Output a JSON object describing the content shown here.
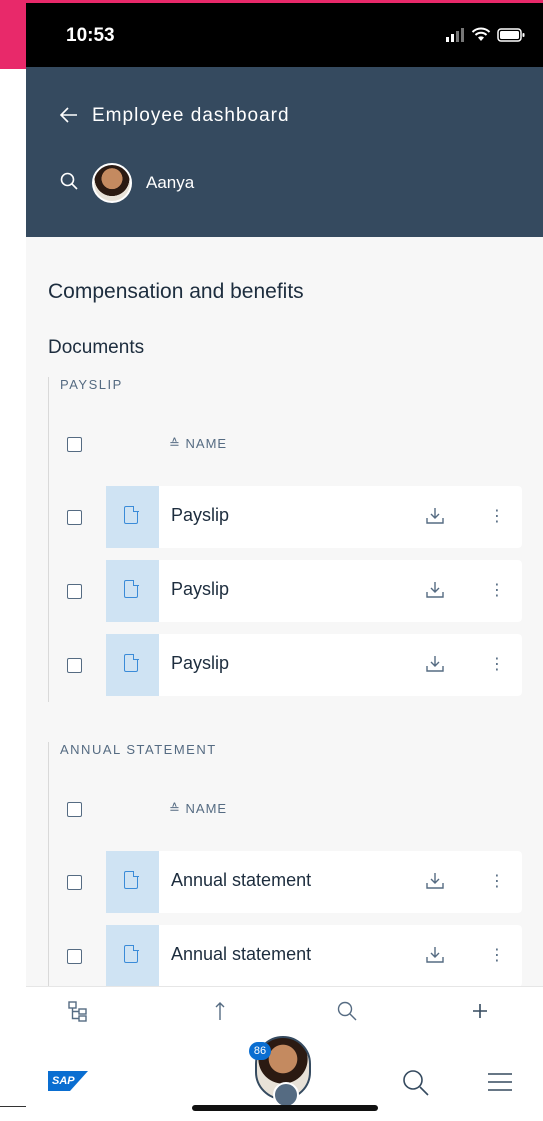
{
  "status": {
    "time": "10:53"
  },
  "header": {
    "title": "Employee dashboard",
    "user_name": "Aanya"
  },
  "page": {
    "section_title": "Compensation and benefits",
    "documents_title": "Documents"
  },
  "groups": [
    {
      "label": "PAYSLIP",
      "column_header": "≙ NAME",
      "rows": [
        {
          "label": "Payslip"
        },
        {
          "label": "Payslip"
        },
        {
          "label": "Payslip"
        }
      ]
    },
    {
      "label": "ANNUAL STATEMENT",
      "column_header": "≙ NAME",
      "rows": [
        {
          "label": "Annual statement"
        },
        {
          "label": "Annual statement"
        }
      ]
    }
  ],
  "bottom": {
    "notification_count": "86",
    "logo_text": "SAP"
  },
  "icons": {
    "back": "arrow-left-icon",
    "search": "search-icon",
    "download": "download-icon",
    "more": "more-vertical-icon"
  },
  "colors": {
    "header_bg": "#354a5f",
    "accent": "#0a6ed1",
    "thumb_bg": "#cfe3f3",
    "pink": "#e8296a"
  }
}
